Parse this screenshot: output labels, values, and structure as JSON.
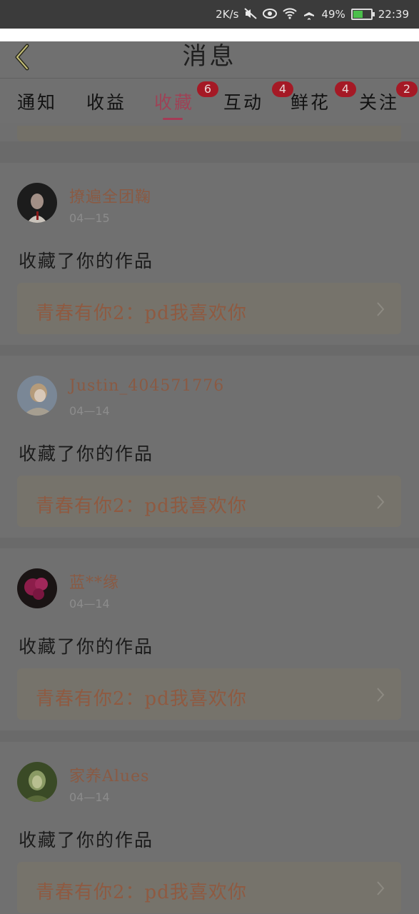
{
  "status_bar": {
    "net_speed": "2K/s",
    "battery_percent": "49%",
    "time": "22:39",
    "icons": [
      "mute-icon",
      "eye-icon",
      "wifi-icon",
      "airplane-icon",
      "battery-icon"
    ]
  },
  "header": {
    "title": "消息",
    "back_icon": "chevron-left-icon"
  },
  "tabs": [
    {
      "label": "通知",
      "badge": ""
    },
    {
      "label": "收益",
      "badge": ""
    },
    {
      "label": "收藏",
      "badge": "6",
      "active": true
    },
    {
      "label": "互动",
      "badge": "4"
    },
    {
      "label": "鲜花",
      "badge": "4"
    },
    {
      "label": "关注",
      "badge": "2"
    }
  ],
  "colors": {
    "accent": "#9e4256",
    "badge": "#a51925",
    "username": "#8a5a43",
    "work_title": "#8f5a41"
  },
  "items": [
    {
      "username": "撩遍全团鞠",
      "date": "04—15",
      "action": "收藏了你的作品",
      "work": "青春有你2：pd我喜欢你"
    },
    {
      "username": "Justin_404571776",
      "date": "04—14",
      "action": "收藏了你的作品",
      "work": "青春有你2：pd我喜欢你"
    },
    {
      "username": "蓝**缘",
      "date": "04—14",
      "action": "收藏了你的作品",
      "work": "青春有你2：pd我喜欢你"
    },
    {
      "username": "家养Alues",
      "date": "04—14",
      "action": "收藏了你的作品",
      "work": "青春有你2：pd我喜欢你"
    }
  ]
}
